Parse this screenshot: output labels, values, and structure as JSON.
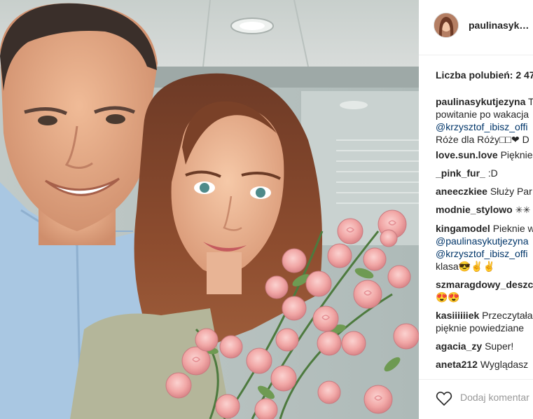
{
  "post": {
    "username": "paulinasyk…",
    "likes_label": "Liczba polubień: 2 47",
    "add_comment_placeholder": "Dodaj komentar",
    "comments": [
      {
        "user": "paulinasykutjezyna",
        "lines": [
          "T",
          "powitanie po wakacja",
          "@krzysztof_ibisz_offi",
          "Róże dla Róży□□❤ D"
        ]
      },
      {
        "user": "love.sun.love",
        "lines": [
          "Pięknie"
        ]
      },
      {
        "user": "_pink_fur_",
        "lines": [
          ":D"
        ]
      },
      {
        "user": "aneeczkiee",
        "lines": [
          "Służy Par"
        ]
      },
      {
        "user": "modnie_stylowo",
        "lines": [
          "✳✳"
        ]
      },
      {
        "user": "kingamodel",
        "lines": [
          "Pieknie w",
          "@paulinasykutjezyna",
          "@krzysztof_ibisz_offi",
          "klasa😎✌✌"
        ]
      },
      {
        "user": "szmaragdowy_deszc",
        "lines": [
          "😍😍"
        ]
      },
      {
        "user": "kasiiiiiiek",
        "lines": [
          "Przeczytała",
          "pięknie powiedziane"
        ]
      },
      {
        "user": "agacia_zy",
        "lines": [
          "Super!"
        ]
      },
      {
        "user": "aneta212",
        "lines": [
          "Wyglądasz"
        ]
      }
    ]
  },
  "icons": {
    "heart": "heart-outline-icon"
  },
  "colors": {
    "link": "#003569",
    "text": "#262626",
    "muted": "#999999",
    "border": "#efefef"
  }
}
